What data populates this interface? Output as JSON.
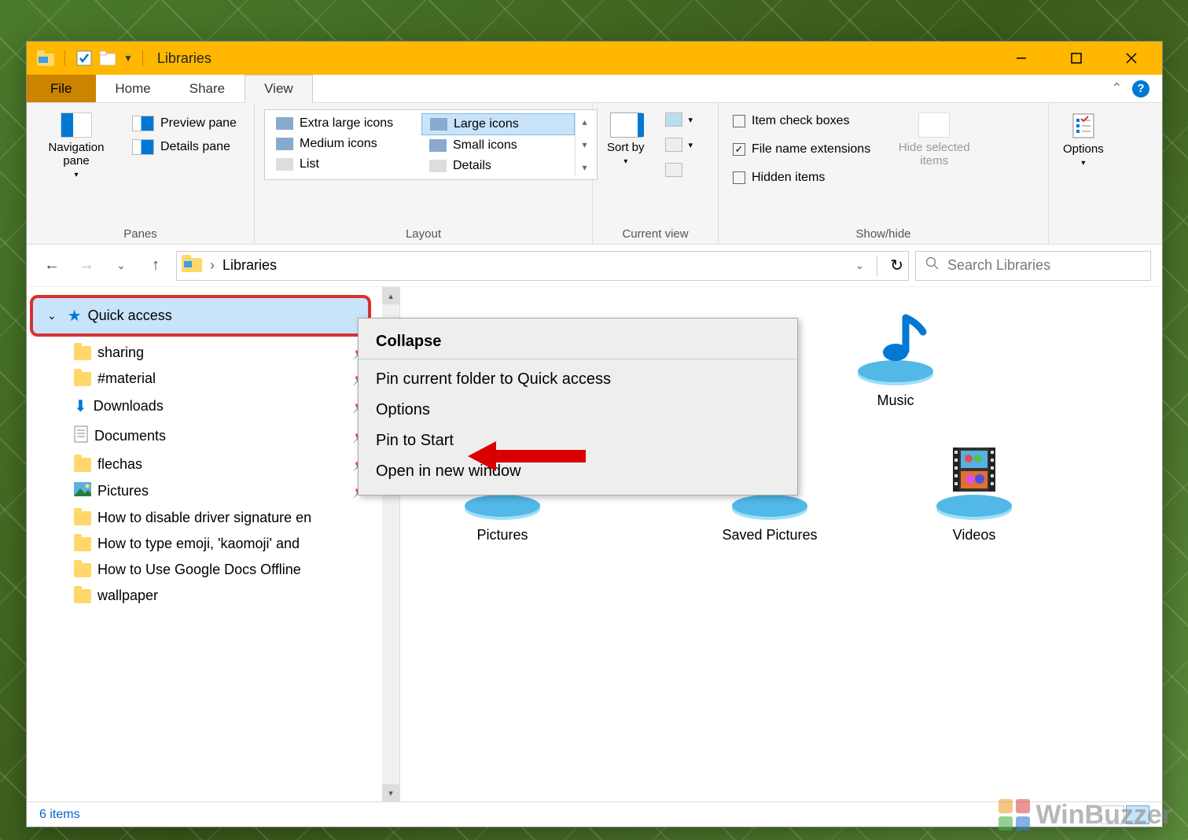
{
  "titlebar": {
    "title": "Libraries"
  },
  "tabs": {
    "file": "File",
    "home": "Home",
    "share": "Share",
    "view": "View"
  },
  "ribbon": {
    "panes": {
      "nav": "Navigation pane",
      "preview": "Preview pane",
      "details": "Details pane",
      "group": "Panes"
    },
    "layout": {
      "xl": "Extra large icons",
      "lg": "Large icons",
      "md": "Medium icons",
      "sm": "Small icons",
      "list": "List",
      "det": "Details",
      "group": "Layout"
    },
    "currentview": {
      "sortby": "Sort by",
      "group": "Current view"
    },
    "showhide": {
      "chk_boxes": "Item check boxes",
      "ext": "File name extensions",
      "hidden": "Hidden items",
      "hidesel": "Hide selected items",
      "group": "Show/hide"
    },
    "options": "Options"
  },
  "address": {
    "location": "Libraries",
    "search_placeholder": "Search Libraries",
    "refresh_symbol": "↻"
  },
  "tree": {
    "quick_access": "Quick access",
    "items": [
      "sharing",
      "#material",
      "Downloads",
      "Documents",
      "flechas",
      "Pictures",
      "How to disable driver signature en",
      "How to type emoji, 'kaomoji' and",
      "How to Use Google Docs Offline",
      "wallpaper"
    ]
  },
  "files": [
    "Music",
    "Pictures",
    "Saved Pictures",
    "Videos"
  ],
  "context_menu": {
    "collapse": "Collapse",
    "pin_current": "Pin current folder to Quick access",
    "options": "Options",
    "pin_start": "Pin to Start",
    "open_new": "Open in new window"
  },
  "statusbar": {
    "count": "6 items"
  },
  "watermark": "WinBuzzer"
}
